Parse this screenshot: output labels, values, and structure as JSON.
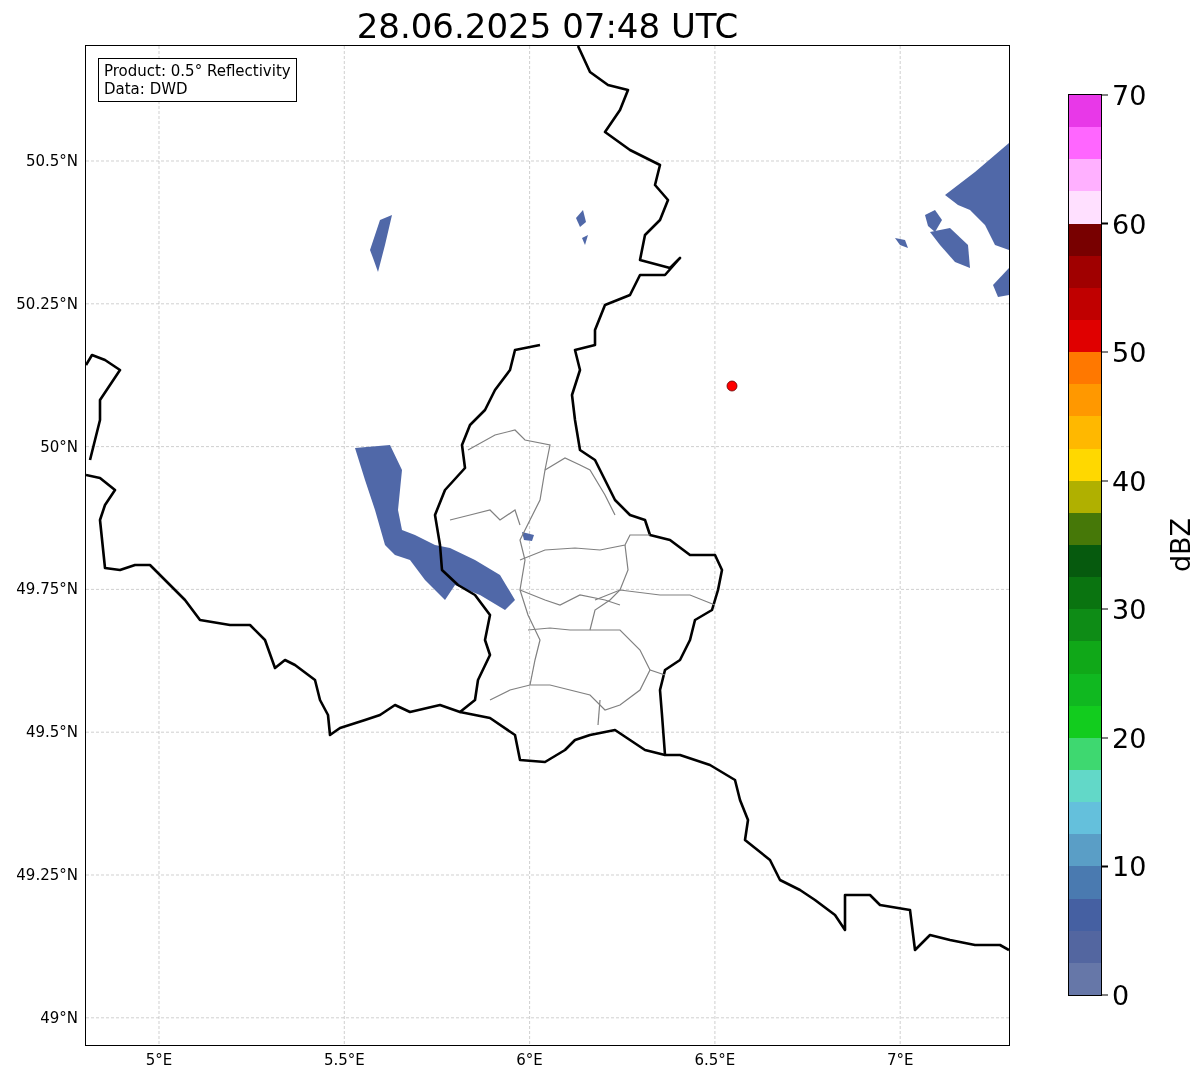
{
  "title": "28.06.2025 07:48 UTC",
  "info_box": {
    "lines": [
      "Product: 0.5° Reflectivity",
      "Data: DWD"
    ]
  },
  "map": {
    "latitude_labels": [
      "50.5°N",
      "50.25°N",
      "50°N",
      "49.75°N",
      "49.5°N",
      "49.25°N",
      "49°N"
    ],
    "longitude_labels": [
      "5°E",
      "5.5°E",
      "6°E",
      "6.5°E",
      "7°E"
    ]
  },
  "colorbar": {
    "label": "dBZ",
    "ticks": [
      "70",
      "60",
      "50",
      "40",
      "30",
      "20",
      "10",
      "0"
    ],
    "bins": [
      {
        "color": "#e838e8"
      },
      {
        "color": "#ff66ff"
      },
      {
        "color": "#ffb0ff"
      },
      {
        "color": "#ffe0ff"
      },
      {
        "color": "#780000"
      },
      {
        "color": "#a00000"
      },
      {
        "color": "#c00000"
      },
      {
        "color": "#e00000"
      },
      {
        "color": "#ff7800"
      },
      {
        "color": "#ff9800"
      },
      {
        "color": "#ffb800"
      },
      {
        "color": "#ffd800"
      },
      {
        "color": "#b0b000"
      },
      {
        "color": "#467808"
      },
      {
        "color": "#065a0e"
      },
      {
        "color": "#0a7410"
      },
      {
        "color": "#0e8c16"
      },
      {
        "color": "#10a818"
      },
      {
        "color": "#10b820"
      },
      {
        "color": "#12cc1e"
      },
      {
        "color": "#3ed870"
      },
      {
        "color": "#62d8c8"
      },
      {
        "color": "#64c0dc"
      },
      {
        "color": "#5a9ec6"
      },
      {
        "color": "#4a7ab0"
      },
      {
        "color": "#4560a2"
      },
      {
        "color": "#5366a0"
      },
      {
        "color": "#6677a8"
      }
    ]
  }
}
